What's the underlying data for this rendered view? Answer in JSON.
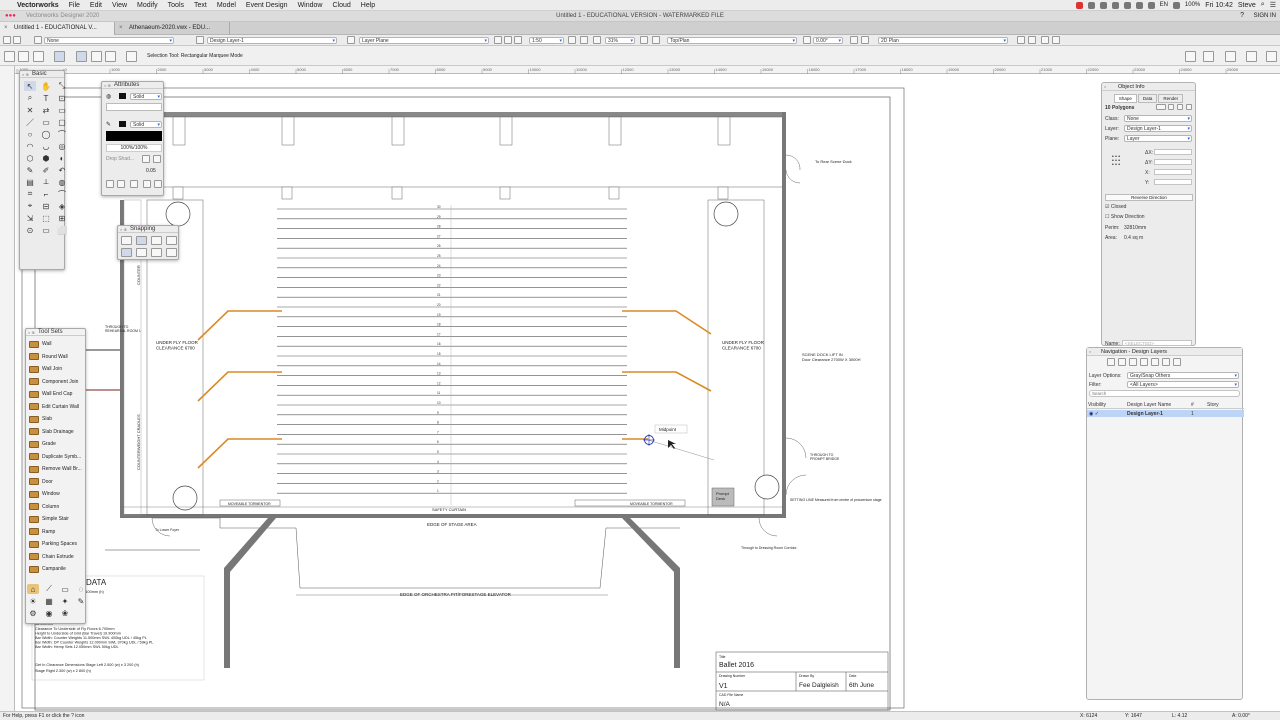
{
  "menubar": {
    "app": "Vectorworks",
    "items": [
      "File",
      "Edit",
      "View",
      "Modify",
      "Tools",
      "Text",
      "Model",
      "Event Design",
      "Window",
      "Cloud",
      "Help"
    ],
    "flag": "EN",
    "battery": "100%",
    "clock": "Fri 10:42",
    "user": "Steve"
  },
  "titlebar": {
    "app_version": "Vectorworks Designer 2020",
    "document": "Untitled 1 - EDUCATIONAL VERSION - WATERMARKED FILE",
    "sign_in": "SIGN IN"
  },
  "tabs": [
    {
      "label": "Untitled 1 - EDUCATIONAL V..."
    },
    {
      "label": "Athenaeum-2020.vwx - EDU..."
    }
  ],
  "viewbar": {
    "class": "None",
    "layer": "Design Layer-1",
    "layer_plane": "Layer Plane",
    "scale": "1:50",
    "zoom": "31%",
    "view": "Top/Plan",
    "rotation": "0.00°",
    "render": "2D Plan"
  },
  "mode_bar": {
    "hint": "Selection Tool: Rectangular Marquee Mode"
  },
  "ruler_ticks": [
    "-1000",
    "0",
    "1000",
    "2000",
    "3000",
    "4000",
    "5000",
    "6000",
    "7000",
    "8000",
    "9000",
    "10000",
    "11000",
    "12000",
    "13000",
    "14000",
    "15000",
    "16000",
    "17000",
    "18000",
    "19000",
    "20000",
    "21000",
    "22000",
    "23000",
    "24000",
    "25000"
  ],
  "palettes": {
    "basic": {
      "title": "Basic"
    },
    "attributes": {
      "title": "Attributes",
      "fill": "Solid",
      "pen": "Solid",
      "opacity": "100%/100%",
      "drop_shadow": "Drop Shad...",
      "thickness": "0.05"
    },
    "snapping": {
      "title": "Snapping"
    },
    "toolsets": {
      "title": "Tool Sets",
      "items": [
        "Wall",
        "Round Wall",
        "Wall Join",
        "Component Join",
        "Wall End Cap",
        "Edit Curtain Wall",
        "Slab",
        "Slab Drainage",
        "Grade",
        "Duplicate Symb...",
        "Remove Wall Br...",
        "Door",
        "Window",
        "Column",
        "Simple Stair",
        "Ramp",
        "Parking Spaces",
        "Chain Extrude",
        "Campanile"
      ]
    }
  },
  "object_info": {
    "title": "Object Info",
    "tabs": [
      "Shape",
      "Data",
      "Render"
    ],
    "object": "10 Polygons",
    "class": "None",
    "layer": "Design Layer-1",
    "plane": "Layer",
    "reverse": "Reverse Direction",
    "closed": "Closed",
    "show_direction": "Show Direction",
    "perim_label": "Perim:",
    "perim_value": "32810mm",
    "area_label": "Area:",
    "area_value": "0.4 sq m",
    "name_label": "Name:",
    "name_value": "<SELECTED>"
  },
  "navigation": {
    "title": "Navigation - Design Layers",
    "layer_options_label": "Layer Options:",
    "layer_options": "Gray/Snap Others",
    "filter_label": "Filter:",
    "filter": "<All Layers>",
    "search_placeholder": "Search",
    "columns": [
      "Visibility",
      "Design Layer Name",
      "#",
      "Story"
    ],
    "rows": [
      {
        "name": "Design Layer-1",
        "num": "1",
        "story": ""
      }
    ]
  },
  "drawing": {
    "labels": {
      "underfly_left": "UNDER FLY FLOOR\nCLEARANCE 6700",
      "underfly_right": "UNDER FLY FLOOR\nCLEARANCE 6700",
      "counterweight": "COUNTERWEIGHT CRADLES",
      "safety_curtain": "SAFETY CURTAIN",
      "edge_stage": "EDGE OF STAGE AREA",
      "edge_orchestra": "EDGE OF ORCHESTRA PIT/FORESTAGE ELEVATOR",
      "movable_left": "MOVEABLE TORMENTOR",
      "movable_right": "MOVEABLE TORMENTOR",
      "to_rear_scene_dock": "To Rear Scene Dock",
      "scene_dock_lift": "SCENE DOCK LIFT IN\nDoor Clearance 2700W X 3000H",
      "through_to_prompt": "THROUGH TO\nPROMPT BRIDGE",
      "rehearsal": "THROUGH TO\nREHEARSAL ROOM 1",
      "prompt_desk": "Prompt\nDesk",
      "setting_line": "SETTING LINE Measured from centre of proscenium stage",
      "through_dressing": "Through to Dressing Room Corridor",
      "to_lower_foyer": "To Lower Foyer",
      "snap_tooltip": "Midpoint",
      "counterweight_short": "COUNTER",
      "data_heading": "DATA"
    },
    "data_rows": [
      "8.000mm - 11.200mm (w) x 7.100mm (h)",
      "13.000mm",
      "9.000mm",
      "Stage/Pit Elevator   2.115mm",
      "2.100mm",
      "9.80mm",
      "20.75 0mm",
      "18.000mm",
      "Clearance To Underside of Fly Floors   6.700mm",
      "Height to Underside of Grid (Bar Travel)   19.900mm",
      "Bar Width: Counter Weights   11.500mm  SWL 400kg UDL / 45kg PL",
      "Bar Width: DP Counter Weights   12.000mm  SWL 370kg UDL / 59kg PL",
      "Bar Width: Hemp Sets   12.050mm  SWL 50kg UDL",
      "Get In Clearance Dimensions   Stage Left   2.500 (w) x 3 200 (h)",
      "Stage Right   2.300 (w) x 2 800 (h)"
    ],
    "title_block": {
      "title_label": "Title",
      "title": "Ballet 2016",
      "drawing_number_label": "Drawing Number",
      "drawing_number": "V1",
      "drawn_by_label": "Drawn By",
      "drawn_by": "Fee Dalgleish",
      "date_label": "Date",
      "date": "6th June",
      "cad_label": "CAD File Name",
      "cad": "N/A"
    },
    "batten_numbers": [
      "30",
      "29",
      "28",
      "27",
      "26",
      "25",
      "24",
      "23",
      "22",
      "21",
      "20",
      "19",
      "18",
      "17",
      "16",
      "15",
      "14",
      "13",
      "12",
      "11",
      "10",
      "9",
      "8",
      "7",
      "6",
      "5",
      "4",
      "3",
      "2",
      "1"
    ]
  },
  "status": {
    "help": "For Help, press F1 or click the ? icon",
    "x": "X: 6124",
    "y": "Y: 1647",
    "l": "L: 4.12",
    "a": "A: 0.00°"
  }
}
